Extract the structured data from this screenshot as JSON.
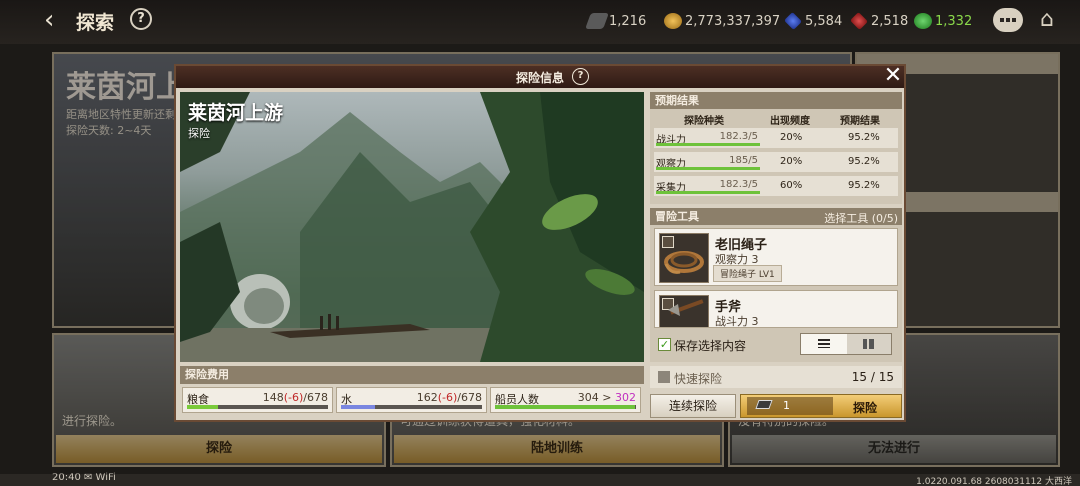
{
  "topbar": {
    "back_icon": "chevron-left-icon",
    "title": "探索",
    "help": "?",
    "resources": [
      {
        "icon": "ticket-icon",
        "value": "1,216"
      },
      {
        "icon": "gold-coin-icon",
        "value": "2,773,337,397"
      },
      {
        "icon": "blue-gem-icon",
        "value": "5,584"
      },
      {
        "icon": "red-gem-icon",
        "value": "2,518"
      },
      {
        "icon": "green-gear-icon",
        "value": "1,332"
      }
    ]
  },
  "background": {
    "left_title": "莱茵河上",
    "left_sub1": "距离地区特性更新还剩",
    "left_sub2": "探险天数: 2~4天",
    "cards": [
      {
        "desc": "进行探险。",
        "button": "探险"
      },
      {
        "desc": "可通过训练获得道具，强化材料。",
        "button": "陆地训练"
      },
      {
        "desc": "没有特别的探险。",
        "button": "无法进行"
      }
    ]
  },
  "status": {
    "left": "20:40 ✉ WiFi",
    "right": "1.0220.091.68 2608031112 大西洋"
  },
  "modal": {
    "title": "探险信息",
    "help": "?",
    "close": "✕",
    "scene": {
      "title": "莱茵河上游",
      "subtitle": "探险"
    },
    "cost": {
      "header": "探险费用",
      "items": [
        {
          "name": "粮食",
          "current": "148",
          "delta": "(-6)",
          "max": "/678",
          "fill": 0.22,
          "color": "#7aca3a"
        },
        {
          "name": "水",
          "current": "162",
          "delta": "(-6)",
          "max": "/678",
          "fill": 0.24,
          "color": "#7a86e0"
        },
        {
          "name": "船员人数",
          "current": "304",
          "sep": " > ",
          "next": "302",
          "fill": 0.99,
          "color": "#6ec23a"
        }
      ]
    },
    "prediction": {
      "header": "预期结果",
      "columns": [
        "探险种类",
        "出现频度",
        "预期结果"
      ],
      "rows": [
        {
          "type": "战斗力",
          "value": "182.3/5",
          "freq": "20%",
          "result": "95.2%",
          "fill": 1.0
        },
        {
          "type": "观察力",
          "value": "185/5",
          "freq": "20%",
          "result": "95.2%",
          "fill": 1.0
        },
        {
          "type": "采集力",
          "value": "182.3/5",
          "freq": "60%",
          "result": "95.2%",
          "fill": 1.0
        }
      ]
    },
    "tools": {
      "header": "冒险工具",
      "select": "选择工具 (0/5)",
      "items": [
        {
          "name": "老旧绳子",
          "stat": "观察力 3",
          "tag": "冒险绳子 LV1",
          "icon": "rope-icon"
        },
        {
          "name": "手斧",
          "stat": "战斗力 3",
          "icon": "hatchet-icon"
        }
      ],
      "save_label": "保存选择内容"
    },
    "quick": {
      "label": "快速探险",
      "count": "15 / 15"
    },
    "continue_button": "连续探险",
    "explore_cost": "1",
    "explore_button": "探险"
  }
}
